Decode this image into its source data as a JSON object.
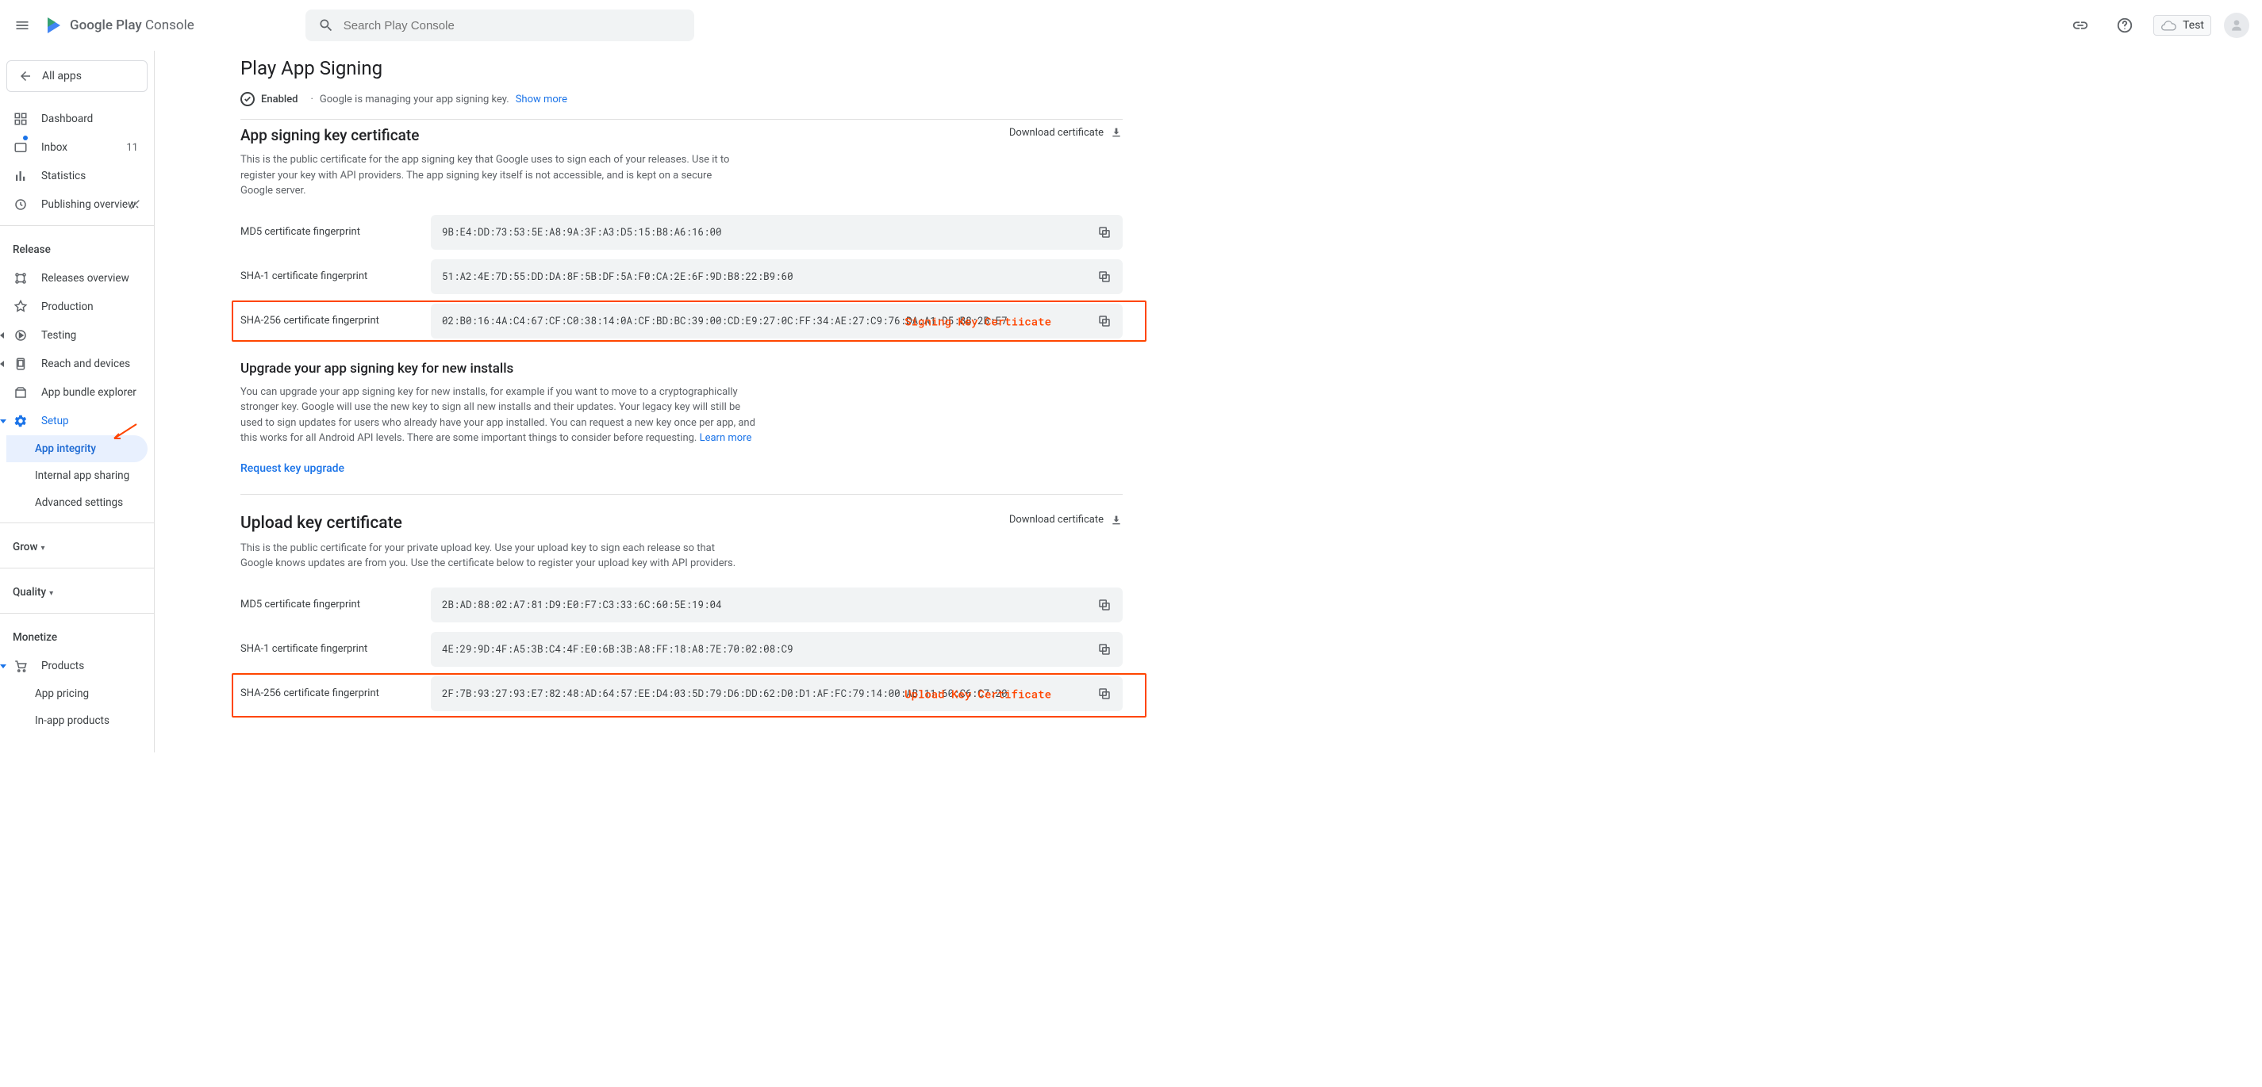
{
  "header": {
    "logo_text_a": "Google Play",
    "logo_text_b": "Console",
    "search_placeholder": "Search Play Console",
    "account_name": "Test"
  },
  "sidebar": {
    "back_label": "All apps",
    "items": {
      "dashboard": "Dashboard",
      "inbox": "Inbox",
      "inbox_count": "11",
      "statistics": "Statistics",
      "publishing": "Publishing overview"
    },
    "release_label": "Release",
    "release_items": {
      "overview": "Releases overview",
      "production": "Production",
      "testing": "Testing",
      "reach": "Reach and devices",
      "bundle": "App bundle explorer",
      "setup": "Setup",
      "integrity": "App integrity",
      "internal": "Internal app sharing",
      "advanced": "Advanced settings"
    },
    "grow_label": "Grow",
    "quality_label": "Quality",
    "monetize_label": "Monetize",
    "monetize_items": {
      "products": "Products",
      "pricing": "App pricing",
      "inapp": "In-app products"
    }
  },
  "page": {
    "title": "Play App Signing",
    "enabled": "Enabled",
    "status_text": "Google is managing your app signing key.",
    "show_more": "Show more"
  },
  "signing": {
    "title": "App signing key certificate",
    "download": "Download certificate",
    "desc": "This is the public certificate for the app signing key that Google uses to sign each of your releases. Use it to register your key with API providers. The app signing key itself is not accessible, and is kept on a secure Google server.",
    "md5_label": "MD5 certificate fingerprint",
    "md5_value": "9B:E4:DD:73:53:5E:A8:9A:3F:A3:D5:15:B8:A6:16:00",
    "sha1_label": "SHA-1 certificate fingerprint",
    "sha1_value": "51:A2:4E:7D:55:DD:DA:8F:5B:DF:5A:F0:CA:2E:6F:9D:B8:22:B9:60",
    "sha256_label": "SHA-256 certificate fingerprint",
    "sha256_value": "02:B0:16:4A:C4:67:CF:C0:38:14:0A:CF:BD:BC:39:00:CD:E9:27:0C:FF:34:AE:27:C9:76:DA:A1:D5:B8:2B:E7",
    "annotation": "Signing Key Certiicate"
  },
  "upgrade": {
    "title": "Upgrade your app signing key for new installs",
    "desc": "You can upgrade your app signing key for new installs, for example if you want to move to a cryptographically stronger key. Google will use the new key to sign all new installs and their updates. Your legacy key will still be used to sign updates for users who already have your app installed. You can request a new key once per app, and this works for all Android API levels. There are some important things to consider before requesting. ",
    "learn_more": "Learn more",
    "request": "Request key upgrade"
  },
  "upload": {
    "title": "Upload key certificate",
    "download": "Download certificate",
    "desc": "This is the public certificate for your private upload key. Use your upload key to sign each release so that Google knows updates are from you. Use the certificate below to register your upload key with API providers.",
    "md5_label": "MD5 certificate fingerprint",
    "md5_value": "2B:AD:88:02:A7:81:D9:E0:F7:C3:33:6C:60:5E:19:04",
    "sha1_label": "SHA-1 certificate fingerprint",
    "sha1_value": "4E:29:9D:4F:A5:3B:C4:4F:E0:6B:3B:A8:FF:18:A8:7E:70:02:08:C9",
    "sha256_label": "SHA-256 certificate fingerprint",
    "sha256_value": "2F:7B:93:27:93:E7:82:48:AD:64:57:EE:D4:03:5D:79:D6:DD:62:D0:D1:AF:FC:79:14:00:AB:11:60:C6:C7:20",
    "annotation": "Upload Key Certificate"
  }
}
